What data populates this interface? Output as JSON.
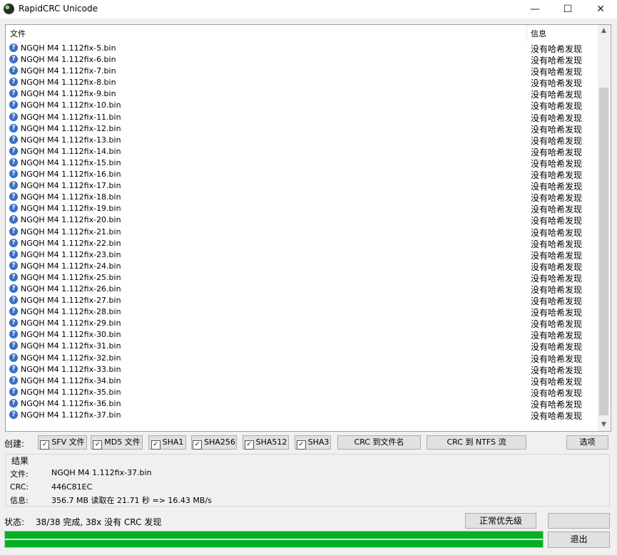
{
  "window": {
    "title": "RapidCRC Unicode",
    "min": "—",
    "max": "☐",
    "close": "✕"
  },
  "list": {
    "header": {
      "file": "文件",
      "info": "信息"
    },
    "rows": [
      {
        "file": "NGQH M4 1.112fix-5.bin",
        "info": "没有哈希发现"
      },
      {
        "file": "NGQH M4 1.112fix-6.bin",
        "info": "没有哈希发现"
      },
      {
        "file": "NGQH M4 1.112fix-7.bin",
        "info": "没有哈希发现"
      },
      {
        "file": "NGQH M4 1.112fix-8.bin",
        "info": "没有哈希发现"
      },
      {
        "file": "NGQH M4 1.112fix-9.bin",
        "info": "没有哈希发现"
      },
      {
        "file": "NGQH M4 1.112fix-10.bin",
        "info": "没有哈希发现"
      },
      {
        "file": "NGQH M4 1.112fix-11.bin",
        "info": "没有哈希发现"
      },
      {
        "file": "NGQH M4 1.112fix-12.bin",
        "info": "没有哈希发现"
      },
      {
        "file": "NGQH M4 1.112fix-13.bin",
        "info": "没有哈希发现"
      },
      {
        "file": "NGQH M4 1.112fix-14.bin",
        "info": "没有哈希发现"
      },
      {
        "file": "NGQH M4 1.112fix-15.bin",
        "info": "没有哈希发现"
      },
      {
        "file": "NGQH M4 1.112fix-16.bin",
        "info": "没有哈希发现"
      },
      {
        "file": "NGQH M4 1.112fix-17.bin",
        "info": "没有哈希发现"
      },
      {
        "file": "NGQH M4 1.112fix-18.bin",
        "info": "没有哈希发现"
      },
      {
        "file": "NGQH M4 1.112fix-19.bin",
        "info": "没有哈希发现"
      },
      {
        "file": "NGQH M4 1.112fix-20.bin",
        "info": "没有哈希发现"
      },
      {
        "file": "NGQH M4 1.112fix-21.bin",
        "info": "没有哈希发现"
      },
      {
        "file": "NGQH M4 1.112fix-22.bin",
        "info": "没有哈希发现"
      },
      {
        "file": "NGQH M4 1.112fix-23.bin",
        "info": "没有哈希发现"
      },
      {
        "file": "NGQH M4 1.112fix-24.bin",
        "info": "没有哈希发现"
      },
      {
        "file": "NGQH M4 1.112fix-25.bin",
        "info": "没有哈希发现"
      },
      {
        "file": "NGQH M4 1.112fix-26.bin",
        "info": "没有哈希发现"
      },
      {
        "file": "NGQH M4 1.112fix-27.bin",
        "info": "没有哈希发现"
      },
      {
        "file": "NGQH M4 1.112fix-28.bin",
        "info": "没有哈希发现"
      },
      {
        "file": "NGQH M4 1.112fix-29.bin",
        "info": "没有哈希发现"
      },
      {
        "file": "NGQH M4 1.112fix-30.bin",
        "info": "没有哈希发现"
      },
      {
        "file": "NGQH M4 1.112fix-31.bin",
        "info": "没有哈希发现"
      },
      {
        "file": "NGQH M4 1.112fix-32.bin",
        "info": "没有哈希发现"
      },
      {
        "file": "NGQH M4 1.112fix-33.bin",
        "info": "没有哈希发现"
      },
      {
        "file": "NGQH M4 1.112fix-34.bin",
        "info": "没有哈希发现"
      },
      {
        "file": "NGQH M4 1.112fix-35.bin",
        "info": "没有哈希发现"
      },
      {
        "file": "NGQH M4 1.112fix-36.bin",
        "info": "没有哈希发现"
      },
      {
        "file": "NGQH M4 1.112fix-37.bin",
        "info": "没有哈希发现"
      }
    ],
    "row_icon": "help-circle-icon"
  },
  "toolbar": {
    "create_label": "创建:",
    "sfv": "SFV 文件",
    "md5": "MD5 文件",
    "sha1": "SHA1",
    "sha256": "SHA256",
    "sha512": "SHA512",
    "sha3": "SHA3",
    "crc_to_filename": "CRC 到文件名",
    "crc_to_ntfs": "CRC 到 NTFS 流",
    "options": "选项",
    "checkbox_mark": "✓"
  },
  "results": {
    "title": "结果",
    "file_label": "文件:",
    "file_value": "NGQH M4 1.112fix-37.bin",
    "crc_label": "CRC:",
    "crc_value": "446C81EC",
    "info_label": "信息:",
    "info_value": "356.7 MB 读取在 21.71 秒 => 16.43 MB/s"
  },
  "status": {
    "label": "状态:",
    "value": "38/38 完成, 38x 没有 CRC 发现",
    "priority": "正常优先级",
    "exit": "退出",
    "progress": 1.0,
    "progress_color": "#06b025"
  }
}
